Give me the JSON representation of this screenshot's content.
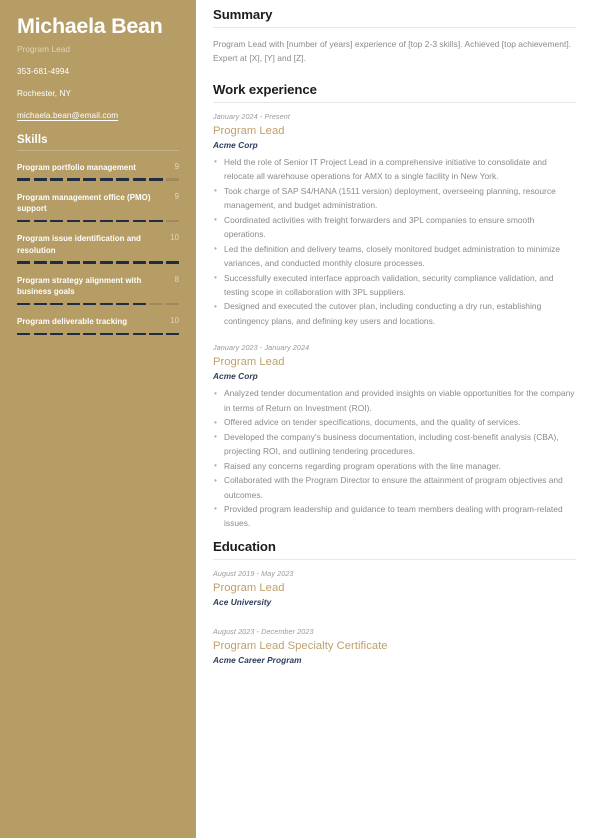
{
  "colors": {
    "sidebar_bg": "#b59d65",
    "accent_gold": "#bfa06a",
    "navy": "#2c3e5d",
    "skill_filled": "#1e2c45",
    "skill_empty": "#a2885a",
    "body_text": "#8a8a8f"
  },
  "sidebar": {
    "full_name": "Michaela Bean",
    "role": "Program Lead",
    "phone": "353-681-4994",
    "location": "Rochester, NY",
    "email": "michaela.bean@email.com",
    "skills_heading": "Skills",
    "skills_max": 10,
    "skills": [
      {
        "name": "Program portfolio management",
        "score": 9
      },
      {
        "name": "Program management office (PMO) support",
        "score": 9
      },
      {
        "name": "Program issue identification and resolution",
        "score": 10
      },
      {
        "name": "Program strategy alignment with business goals",
        "score": 8
      },
      {
        "name": "Program deliverable tracking",
        "score": 10
      }
    ]
  },
  "main": {
    "summary": {
      "heading": "Summary",
      "text": "Program Lead with [number of years] experience of [top 2-3 skills]. Achieved [top achievement]. Expert at [X], [Y] and [Z]."
    },
    "work": {
      "heading": "Work experience",
      "entries": [
        {
          "dates": "January 2024 - Present",
          "title": "Program Lead",
          "org": "Acme Corp",
          "bullets": [
            "Held the role of Senior IT Project Lead in a comprehensive initiative to consolidate and relocate all warehouse operations for AMX to a single facility in New York.",
            "Took charge of SAP S4/HANA (1511 version) deployment, overseeing planning, resource management, and budget administration.",
            "Coordinated activities with freight forwarders and 3PL companies to ensure smooth operations.",
            "Led the definition and delivery teams, closely monitored budget administration to minimize variances, and conducted monthly closure processes.",
            "Successfully executed interface approach validation, security compliance validation, and testing scope in collaboration with 3PL suppliers.",
            "Designed and executed the cutover plan, including conducting a dry run, establishing contingency plans, and defining key users and locations."
          ]
        },
        {
          "dates": "January 2023 - January 2024",
          "title": "Program Lead",
          "org": "Acme Corp",
          "bullets": [
            "Analyzed tender documentation and provided insights on viable opportunities for the company in terms of Return on Investment (ROI).",
            "Offered advice on tender specifications, documents, and the quality of services.",
            "Developed the company's business documentation, including cost-benefit analysis (CBA), projecting ROI, and outlining tendering procedures.",
            "Raised any concerns regarding program operations with the line manager.",
            "Collaborated with the Program Director to ensure the attainment of program objectives and outcomes.",
            "Provided program leadership and guidance to team members dealing with program-related issues."
          ]
        }
      ]
    },
    "education": {
      "heading": "Education",
      "entries": [
        {
          "dates": "August 2019 - May 2023",
          "title": "Program Lead",
          "org": "Ace University"
        },
        {
          "dates": "August 2023 - December 2023",
          "title": "Program Lead Specialty Certificate",
          "org": "Acme Career Program"
        }
      ]
    }
  }
}
